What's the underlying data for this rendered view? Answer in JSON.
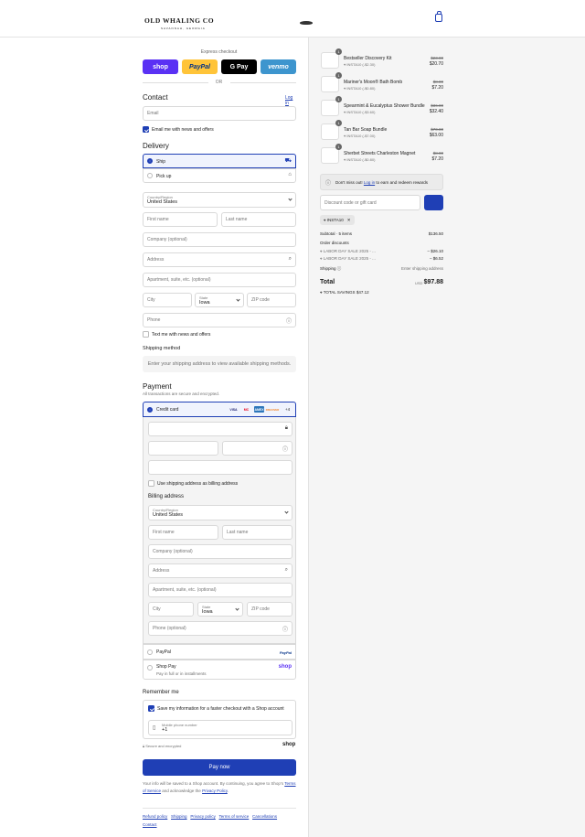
{
  "brand": {
    "name": "OLD WHALING CO",
    "tagline": "SAVANNAH, GEORGIA"
  },
  "colors": {
    "accent": "#1f3fb5",
    "shop": "#5a31f4",
    "paypal": "#ffc439",
    "gpay": "#000000",
    "venmo": "#3d95ce"
  },
  "express": {
    "title": "Express checkout",
    "or": "OR",
    "shop": "shop",
    "paypal": "PayPal",
    "gpay": "G Pay",
    "venmo": "venmo"
  },
  "contact": {
    "heading": "Contact",
    "login": "Log in",
    "email_placeholder": "Email",
    "news_label": "Email me with news and offers"
  },
  "delivery": {
    "heading": "Delivery",
    "ship": "Ship",
    "pickup": "Pick up",
    "country_label": "Country/Region",
    "country": "United States",
    "first_name": "First name",
    "last_name": "Last name",
    "company": "Company (optional)",
    "address": "Address",
    "apartment": "Apartment, suite, etc. (optional)",
    "city": "City",
    "state_label": "State",
    "state": "Iowa",
    "zip": "ZIP code",
    "phone": "Phone",
    "text_label": "Text me with news and offers"
  },
  "shipping_method": {
    "heading": "Shipping method",
    "note": "Enter your shipping address to view available shipping methods."
  },
  "payment": {
    "heading": "Payment",
    "secure": "All transactions are secure and encrypted.",
    "credit_card": "Credit card",
    "cards": [
      "VISA",
      "MC",
      "AMEX",
      "DISCOVER"
    ],
    "more_cards": "+4",
    "use_shipping": "Use shipping address as billing address",
    "billing_heading": "Billing address",
    "billing_phone": "Phone (optional)",
    "paypal": "PayPal",
    "paypal_logo": "PayPal",
    "shop_pay": "Shop Pay",
    "shop_pay_sub": "Pay in full or in installments",
    "shop_logo": "shop"
  },
  "remember": {
    "heading": "Remember me",
    "save_label": "Save my information for a faster checkout with a Shop account",
    "mobile_label": "Mobile phone number",
    "mobile_value": "+1",
    "secure": "Secure and encrypted",
    "shop_logo": "shop"
  },
  "pay_now": "Pay now",
  "terms": {
    "text1": "Your info will be saved to a Shop account. By continuing, you agree to Shop’s",
    "tos": "Terms of Service",
    "text2": "and acknowledge the",
    "privacy": "Privacy Policy",
    "end": "."
  },
  "footer_links": [
    "Refund policy",
    "Shipping",
    "Privacy policy",
    "Terms of service",
    "Cancellations",
    "Contact"
  ],
  "items": [
    {
      "qty": "1",
      "name": "Bestseller Discovery Kit",
      "discount": "INSTA10 (-$2.30)",
      "old": "$23.00",
      "price": "$20.70"
    },
    {
      "qty": "1",
      "name": "Mariner's Moon® Bath Bomb",
      "discount": "INSTA10 (-$0.80)",
      "old": "$8.00",
      "price": "$7.20"
    },
    {
      "qty": "1",
      "name": "Spearmint & Eucalyptus Shower Bundle",
      "discount": "INSTA10 (-$3.60)",
      "old": "$36.00",
      "price": "$32.40"
    },
    {
      "qty": "1",
      "name": "Tan Bar Soap Bundle",
      "discount": "INSTA10 (-$7.00)",
      "old": "$70.00",
      "price": "$63.00"
    },
    {
      "qty": "1",
      "name": "Sherbet Streets Charleston Magnet",
      "discount": "INSTA10 (-$0.80)",
      "old": "$8.00",
      "price": "$7.20"
    }
  ],
  "rewards": {
    "text1": "Don't miss out!",
    "login": "Log in",
    "text2": "to earn and redeem rewards"
  },
  "discount": {
    "placeholder": "Discount code or gift card",
    "applied": "INSTA10"
  },
  "summary": {
    "subtotal_label": "Subtotal · 5 items",
    "subtotal": "$136.50",
    "order_discounts": "Order discounts",
    "disc1_label": "LABOR DAY SALE 2025 - ...",
    "disc1": "– $26.10",
    "disc2_label": "LABOR DAY SALE 2025 - ...",
    "disc2": "– $6.52",
    "shipping_label": "Shipping",
    "shipping_value": "Enter shipping address",
    "total_label": "Total",
    "currency": "USD",
    "total": "$97.88",
    "savings_label": "TOTAL SAVINGS",
    "savings": "$47.12"
  }
}
